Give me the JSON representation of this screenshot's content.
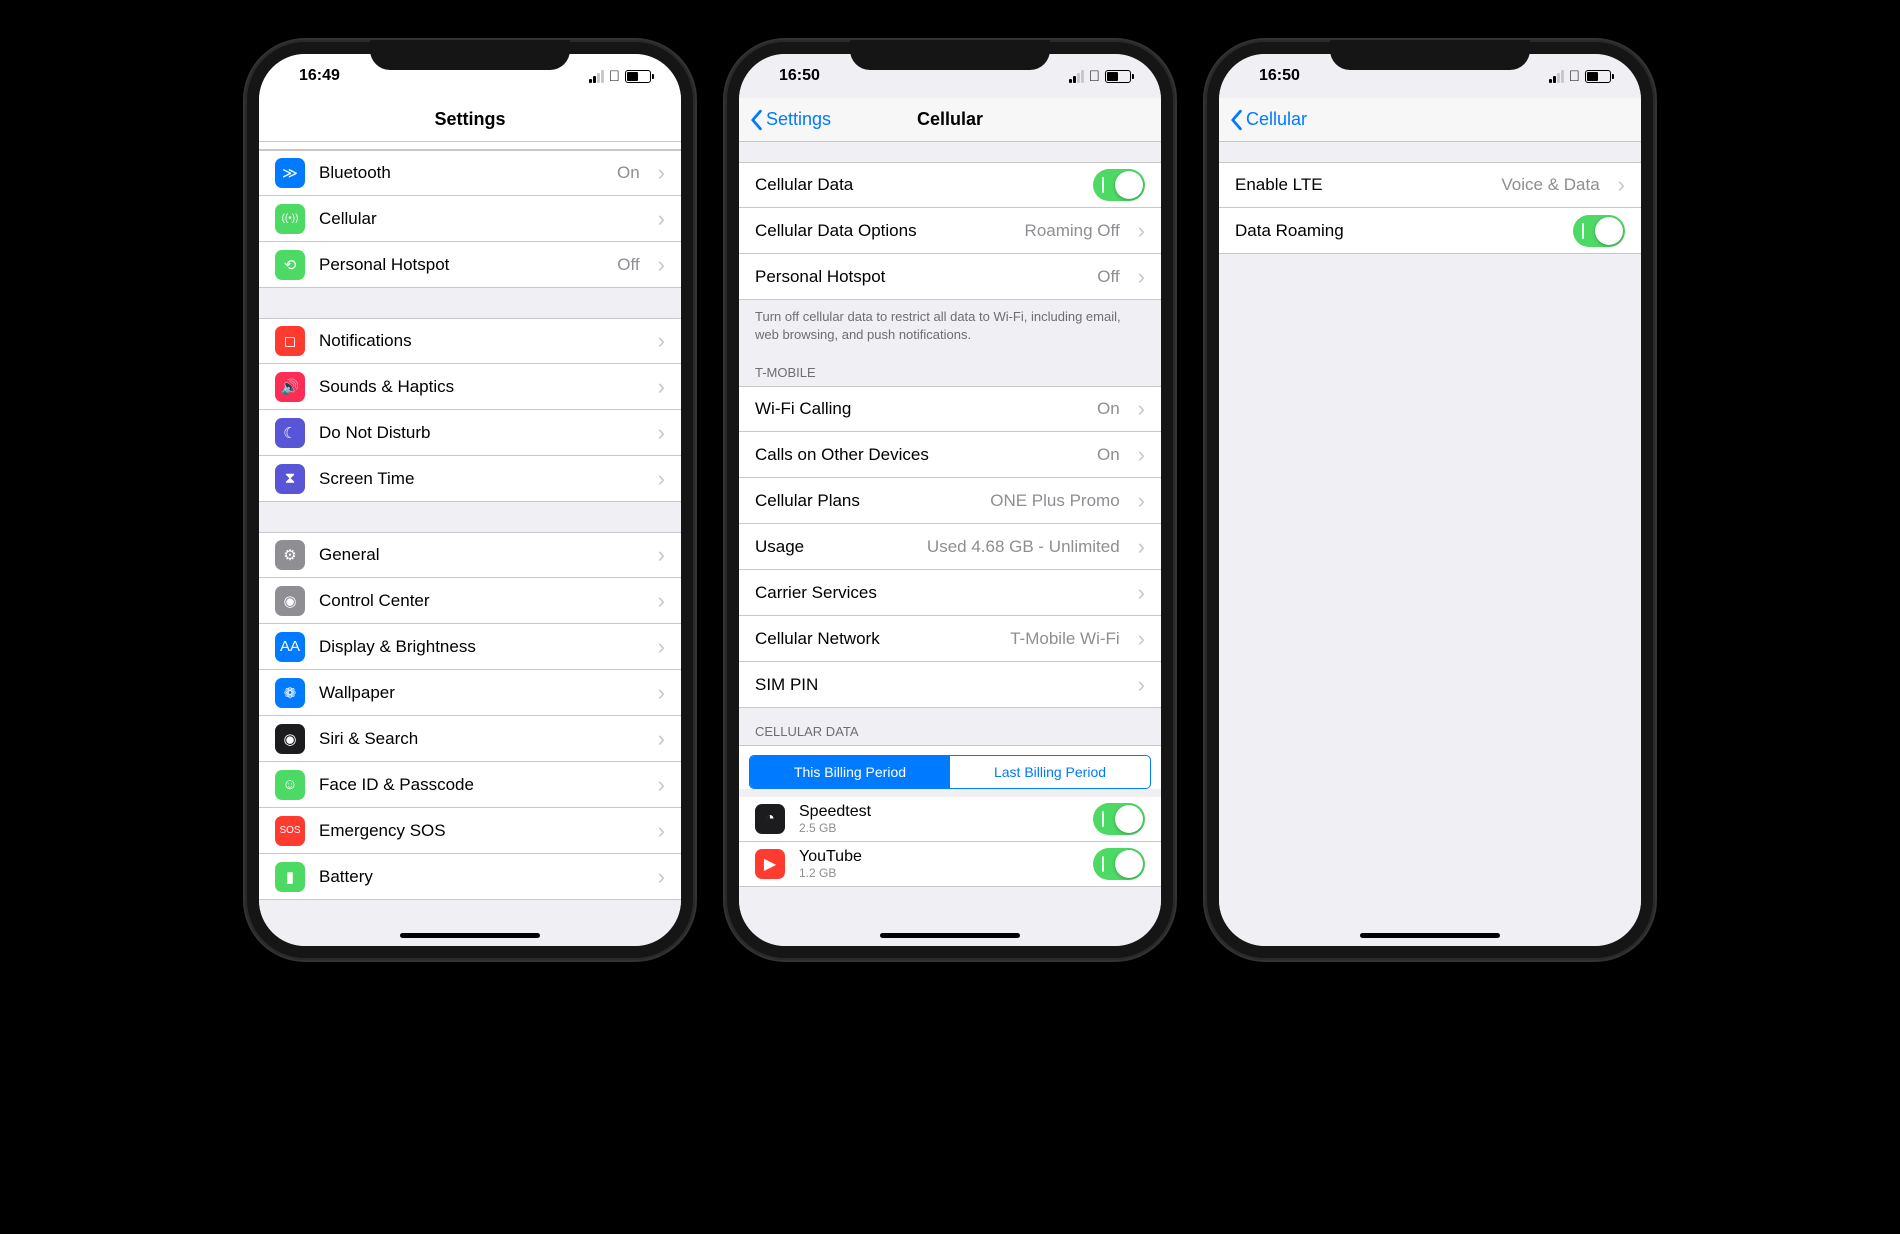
{
  "status": {
    "time1": "16:49",
    "time2": "16:50",
    "time3": "16:50"
  },
  "p1": {
    "title": "Settings",
    "rows_g1": [
      {
        "icon": "bluetooth-icon",
        "bg": "bg-blue",
        "glyph": "≫",
        "label": "Bluetooth",
        "value": "On"
      },
      {
        "icon": "cellular-icon",
        "bg": "bg-green",
        "glyph": "((•))",
        "label": "Cellular",
        "value": ""
      },
      {
        "icon": "hotspot-icon",
        "bg": "bg-green",
        "glyph": "⟲",
        "label": "Personal Hotspot",
        "value": "Off"
      }
    ],
    "rows_g2": [
      {
        "icon": "notifications-icon",
        "bg": "bg-red",
        "glyph": "◻",
        "label": "Notifications",
        "value": ""
      },
      {
        "icon": "sounds-icon",
        "bg": "bg-darkred",
        "glyph": "🔊",
        "label": "Sounds & Haptics",
        "value": ""
      },
      {
        "icon": "dnd-icon",
        "bg": "bg-purple",
        "glyph": "☾",
        "label": "Do Not Disturb",
        "value": ""
      },
      {
        "icon": "screentime-icon",
        "bg": "bg-purple",
        "glyph": "⧗",
        "label": "Screen Time",
        "value": ""
      }
    ],
    "rows_g3": [
      {
        "icon": "general-icon",
        "bg": "bg-grey",
        "glyph": "⚙",
        "label": "General",
        "value": ""
      },
      {
        "icon": "controlcenter-icon",
        "bg": "bg-grey",
        "glyph": "◉",
        "label": "Control Center",
        "value": ""
      },
      {
        "icon": "display-icon",
        "bg": "bg-blue",
        "glyph": "AA",
        "label": "Display & Brightness",
        "value": ""
      },
      {
        "icon": "wallpaper-icon",
        "bg": "bg-blue",
        "glyph": "❁",
        "label": "Wallpaper",
        "value": ""
      },
      {
        "icon": "siri-icon",
        "bg": "bg-black",
        "glyph": "◉",
        "label": "Siri & Search",
        "value": ""
      },
      {
        "icon": "faceid-icon",
        "bg": "bg-green",
        "glyph": "☺",
        "label": "Face ID & Passcode",
        "value": ""
      },
      {
        "icon": "sos-icon",
        "bg": "bg-red",
        "glyph": "SOS",
        "label": "Emergency SOS",
        "value": ""
      },
      {
        "icon": "battery-icon",
        "bg": "bg-green",
        "glyph": "▮",
        "label": "Battery",
        "value": ""
      }
    ]
  },
  "p2": {
    "back": "Settings",
    "title": "Cellular",
    "g1": [
      {
        "label": "Cellular Data",
        "type": "switch"
      },
      {
        "label": "Cellular Data Options",
        "value": "Roaming Off",
        "type": "link"
      },
      {
        "label": "Personal Hotspot",
        "value": "Off",
        "type": "link"
      }
    ],
    "footer1": "Turn off cellular data to restrict all data to Wi-Fi, including email, web browsing, and push notifications.",
    "header2": "T-MOBILE",
    "g2": [
      {
        "label": "Wi-Fi Calling",
        "value": "On"
      },
      {
        "label": "Calls on Other Devices",
        "value": "On"
      },
      {
        "label": "Cellular Plans",
        "value": "ONE Plus Promo"
      },
      {
        "label": "Usage",
        "value": "Used 4.68 GB - Unlimited"
      },
      {
        "label": "Carrier Services",
        "value": ""
      },
      {
        "label": "Cellular Network",
        "value": "T-Mobile Wi-Fi"
      },
      {
        "label": "SIM PIN",
        "value": ""
      }
    ],
    "header3": "CELLULAR DATA",
    "seg": [
      "This Billing Period",
      "Last Billing Period"
    ],
    "apps": [
      {
        "icon": "speedtest-icon",
        "bg": "bg-black",
        "name": "Speedtest",
        "sub": "2.5 GB"
      },
      {
        "icon": "youtube-icon",
        "bg": "bg-red",
        "name": "YouTube",
        "sub": "1.2 GB"
      }
    ]
  },
  "p3": {
    "back": "Cellular",
    "rows": [
      {
        "label": "Enable LTE",
        "value": "Voice & Data",
        "type": "link"
      },
      {
        "label": "Data Roaming",
        "type": "switch"
      }
    ]
  }
}
